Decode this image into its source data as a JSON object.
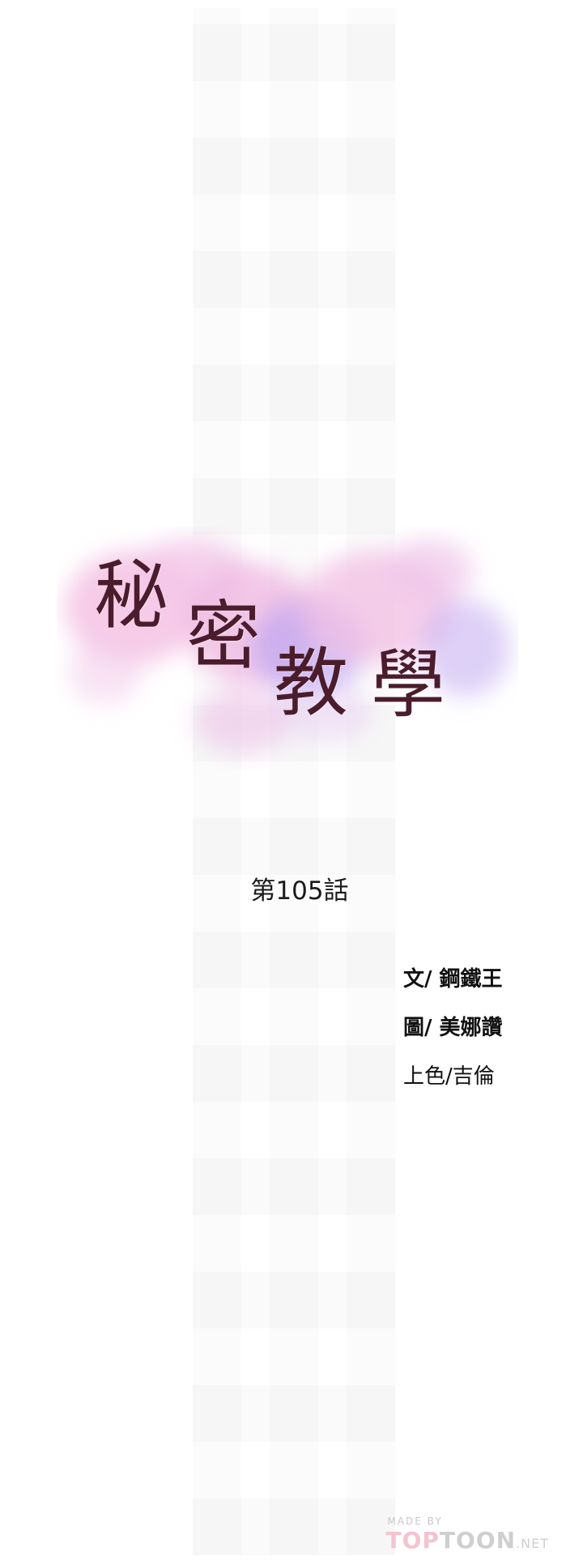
{
  "logo": {
    "title_chars": [
      "秘",
      "密",
      "教",
      "學"
    ],
    "colors": {
      "title": "#4b1c2c",
      "pink": "#f2b8dc",
      "purple": "#b9a2f0",
      "lavender": "#e6c6f2"
    }
  },
  "episode": {
    "label": "第105話"
  },
  "credits": {
    "story": "文/ 鋼鐵王",
    "art": "圖/ 美娜讚",
    "color": "上色/吉倫"
  },
  "footer": {
    "made_by": "MADE BY",
    "brand_top": "TOP",
    "brand_toon": "TOON",
    "brand_net": ".NET"
  }
}
